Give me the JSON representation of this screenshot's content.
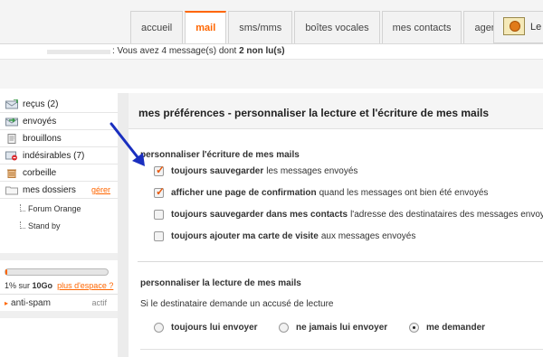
{
  "tabs": [
    {
      "label": "accueil"
    },
    {
      "label": "mail",
      "active": true
    },
    {
      "label": "sms/mms"
    },
    {
      "label": "boîtes vocales"
    },
    {
      "label": "mes contacts"
    },
    {
      "label": "agenda"
    }
  ],
  "right_tab": {
    "label": "Le"
  },
  "status": {
    "prefix": ": Vous avez 4 message(s) dont",
    "unread": "2 non lu(s)"
  },
  "sidebar": {
    "folders": [
      {
        "label": "reçus (2)",
        "icon": "inbox-icon"
      },
      {
        "label": "envoyés",
        "icon": "sent-icon"
      },
      {
        "label": "brouillons",
        "icon": "drafts-icon"
      },
      {
        "label": "indésirables (7)",
        "icon": "spam-icon"
      },
      {
        "label": "corbeille",
        "icon": "trash-icon"
      },
      {
        "label": "mes dossiers",
        "icon": "folder-icon",
        "action": "gérer"
      }
    ],
    "subfolders": [
      "Forum Orange",
      "Stand by"
    ],
    "quota": {
      "percent_text": "1% sur",
      "capacity": "10Go",
      "link": "plus d'espace ?",
      "used_fraction": 0.01
    },
    "antispam": {
      "label": "anti-spam",
      "status": "actif"
    }
  },
  "main": {
    "title": "mes préférences - personnaliser la lecture et l'écriture de mes mails",
    "writing": {
      "title": "personnaliser l'écriture de mes mails",
      "options": [
        {
          "bold": "toujours sauvegarder",
          "rest": "les messages envoyés",
          "checked": true
        },
        {
          "bold": "afficher une page de confirmation",
          "rest": "quand les messages ont bien été envoyés",
          "checked": true
        },
        {
          "bold": "toujours sauvegarder dans mes contacts",
          "rest": "l'adresse des destinataires des messages envoyés",
          "checked": false
        },
        {
          "bold": "toujours ajouter ma carte de visite",
          "rest": "aux messages envoyés",
          "checked": false
        }
      ]
    },
    "reading": {
      "title": "personnaliser la lecture de mes mails",
      "question": "Si le destinataire demande un accusé de lecture",
      "choices": [
        {
          "label": "toujours lui envoyer",
          "selected": false
        },
        {
          "label": "ne jamais lui envoyer",
          "selected": false
        },
        {
          "label": "me demander",
          "selected": true
        }
      ]
    }
  },
  "colors": {
    "accent": "#ff6600",
    "annotation_arrow": "#1a2fbf"
  }
}
